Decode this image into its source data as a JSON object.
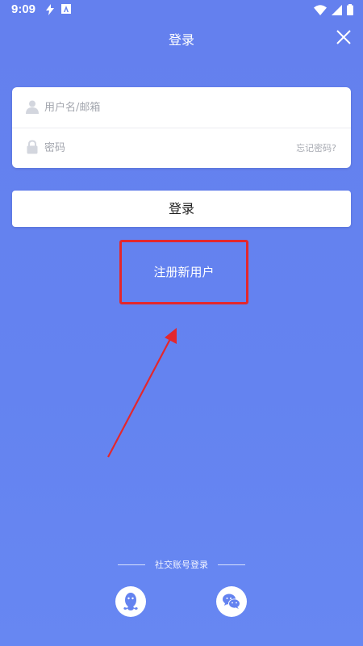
{
  "status_bar": {
    "time": "9:09",
    "icons": [
      "flash-icon",
      "accessibility-icon",
      "wifi-icon",
      "signal-icon",
      "battery-icon"
    ]
  },
  "header": {
    "title": "登录",
    "close_icon": "close-icon"
  },
  "form": {
    "username_placeholder": "用户名/邮箱",
    "username_value": "",
    "password_placeholder": "密码",
    "password_value": "",
    "forgot_label": "忘记密码?"
  },
  "login_button_label": "登录",
  "register_label": "注册新用户",
  "social": {
    "title": "社交账号登录",
    "providers": [
      "qq-icon",
      "wechat-icon"
    ]
  },
  "colors": {
    "background": "#6483f0",
    "highlight": "#e3272d",
    "accent_icon": "#6483f0"
  }
}
